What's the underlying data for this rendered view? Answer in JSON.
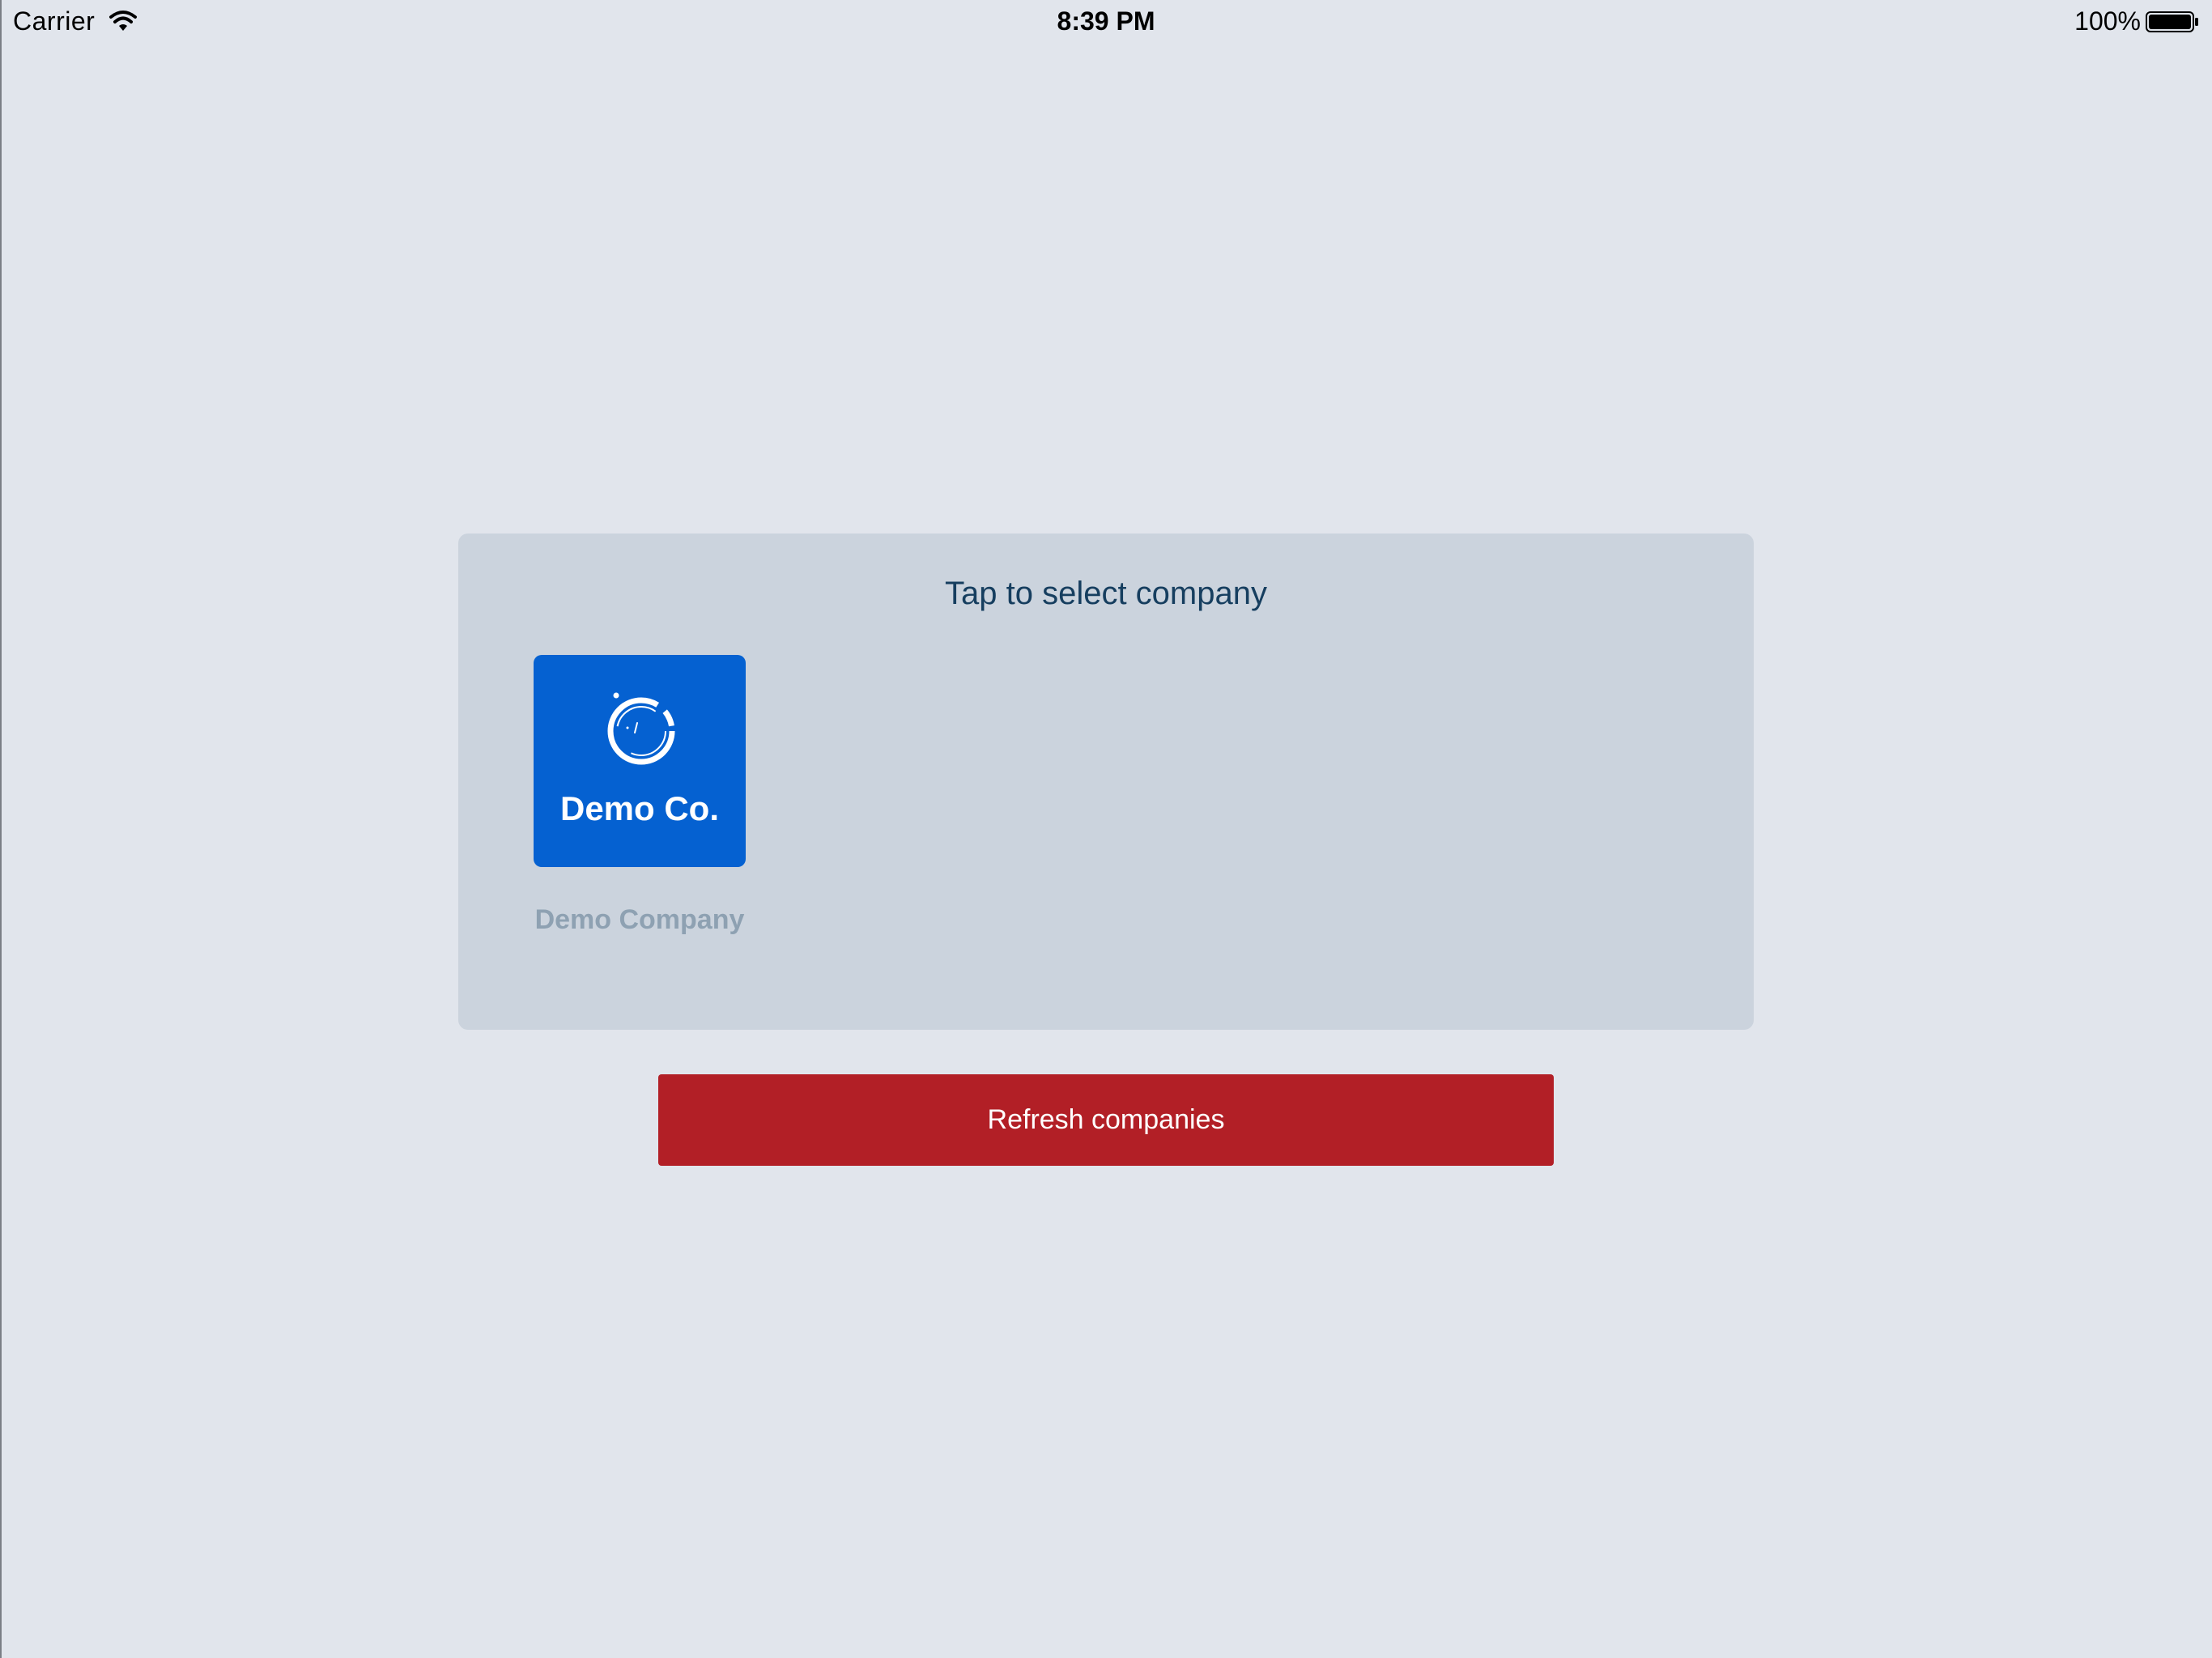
{
  "status_bar": {
    "carrier": "Carrier",
    "time": "8:39 PM",
    "battery_percent": "100%",
    "wifi_icon": "wifi-icon",
    "battery_icon": "battery-icon"
  },
  "company_picker": {
    "title": "Tap to select company",
    "companies": [
      {
        "logo_text": "Demo Co.",
        "logo_icon": "circle-logo-icon",
        "name": "Demo Company",
        "tile_color": "#0561d1"
      }
    ]
  },
  "actions": {
    "refresh_label": "Refresh companies",
    "refresh_color": "#b21f26"
  },
  "colors": {
    "background": "#e1e5ec",
    "card": "#cbd3dd",
    "title_text": "#163e5f",
    "company_name_text": "#8ea1b2"
  }
}
